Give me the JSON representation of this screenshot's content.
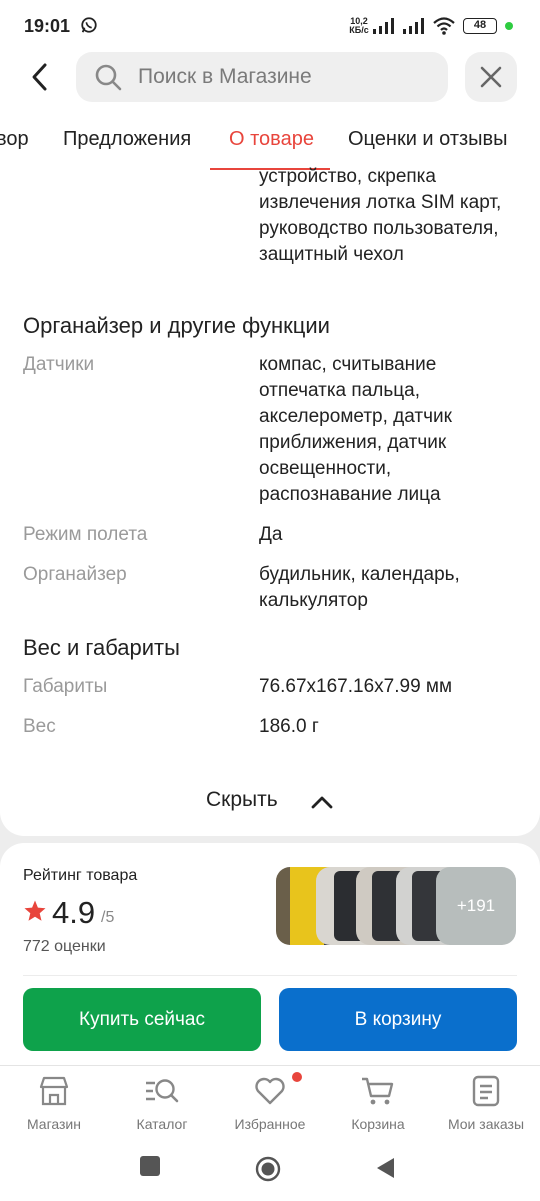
{
  "status_bar": {
    "time": "19:01",
    "net_speed": "10,2\nКБ/с",
    "battery": "48"
  },
  "search": {
    "placeholder": "Поиск в Магазине"
  },
  "tabs": [
    {
      "label": "вор"
    },
    {
      "label": "Предложения"
    },
    {
      "label": "О товаре",
      "active": true
    },
    {
      "label": "Оценки и отзывы"
    }
  ],
  "specs": {
    "package_tail": "устройство, скрепка извлечения лотка SIM карт, руководство пользователя, защитный чехол",
    "section_organizer": "Органайзер и другие функции",
    "sensors_label": "Датчики",
    "sensors_value": "компас, считывание отпечатка пальца, акселерометр, датчик приближения, датчик освещенности, распознавание лица",
    "flight_label": "Режим полета",
    "flight_value": "Да",
    "organizer_label": "Органайзер",
    "organizer_value": "будильник, календарь, калькулятор",
    "section_weight": "Вес и габариты",
    "dims_label": "Габариты",
    "dims_value": "76.67x167.16x7.99 мм",
    "weight_label": "Вес",
    "weight_value": "186.0 г",
    "hide_label": "Скрыть"
  },
  "rating": {
    "title": "Рейтинг товара",
    "score": "4.9",
    "max": "/5",
    "count": "772 оценки",
    "more_photos": "+191"
  },
  "actions": {
    "buy_now": "Купить сейчас",
    "add_to_cart": "В корзину"
  },
  "nav": [
    {
      "label": "Магазин",
      "icon": "store-icon"
    },
    {
      "label": "Каталог",
      "icon": "catalog-search-icon"
    },
    {
      "label": "Избранное",
      "icon": "heart-icon"
    },
    {
      "label": "Корзина",
      "icon": "cart-icon"
    },
    {
      "label": "Мои заказы",
      "icon": "orders-icon"
    }
  ],
  "colors": {
    "accent": "#e8453c",
    "buy": "#0ea24b",
    "cart": "#0a6fcc"
  }
}
